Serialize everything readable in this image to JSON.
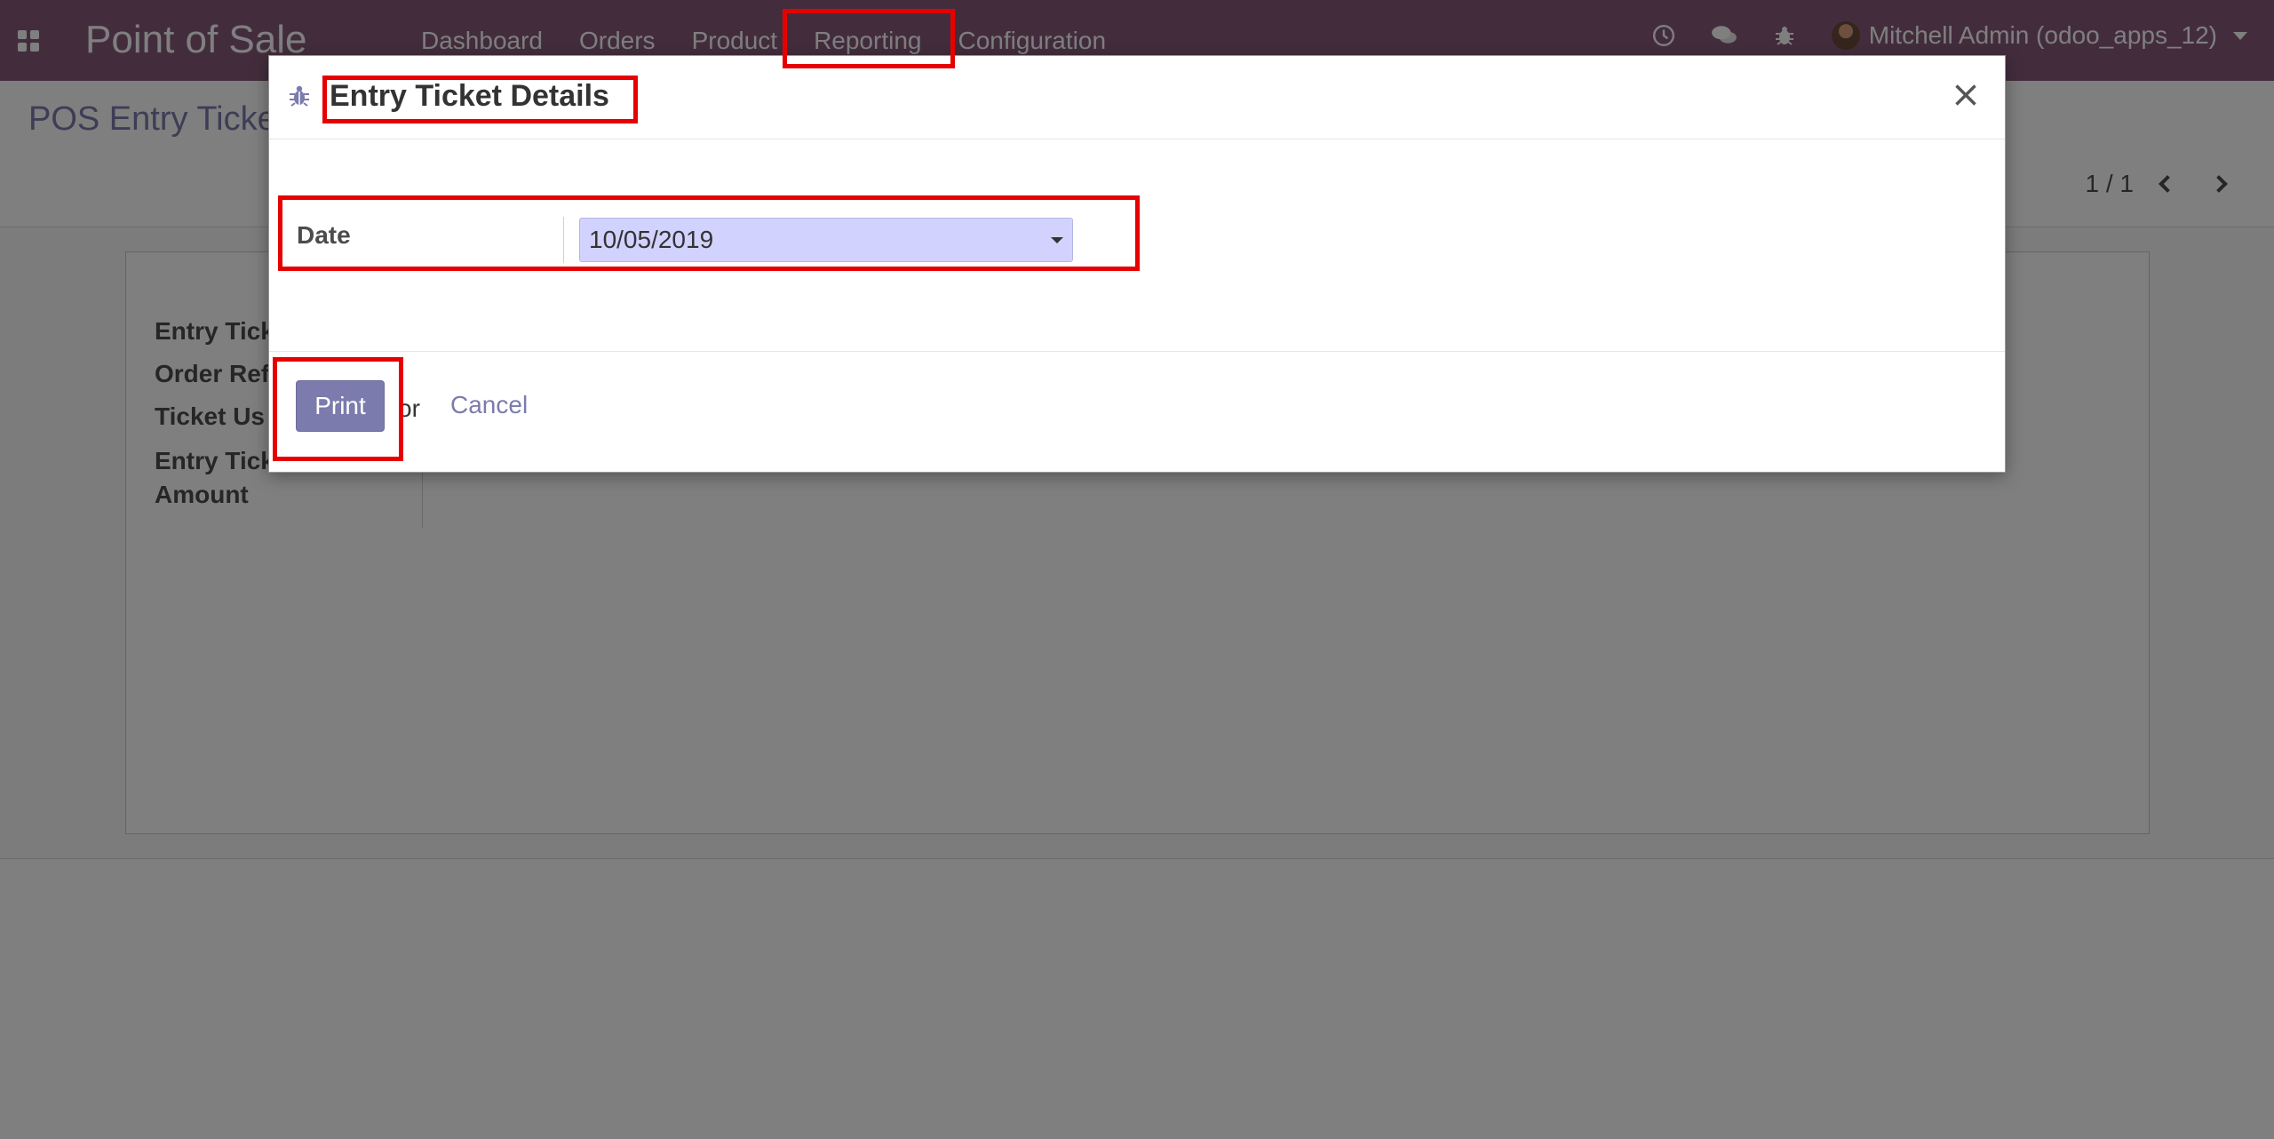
{
  "navbar": {
    "brand": "Point of Sale",
    "menu": [
      "Dashboard",
      "Orders",
      "Product",
      "Reporting",
      "Configuration"
    ],
    "user": "Mitchell Admin (odoo_apps_12)"
  },
  "control_panel": {
    "breadcrumb": "POS Entry Ticke",
    "pager": "1 / 1"
  },
  "form": {
    "fields": [
      "Entry Tick",
      "Order Ref",
      "Ticket Us",
      "Entry Tick",
      "Amount"
    ]
  },
  "modal": {
    "title": "Entry Ticket Details",
    "date_label": "Date",
    "date_value": "10/05/2019",
    "print_label": "Print",
    "or_text": "or",
    "cancel_label": "Cancel"
  },
  "colors": {
    "navbar": "#875a7b",
    "primary": "#7c7bad",
    "annotation": "#e60000",
    "date_input_bg": "#d2d2ff"
  }
}
